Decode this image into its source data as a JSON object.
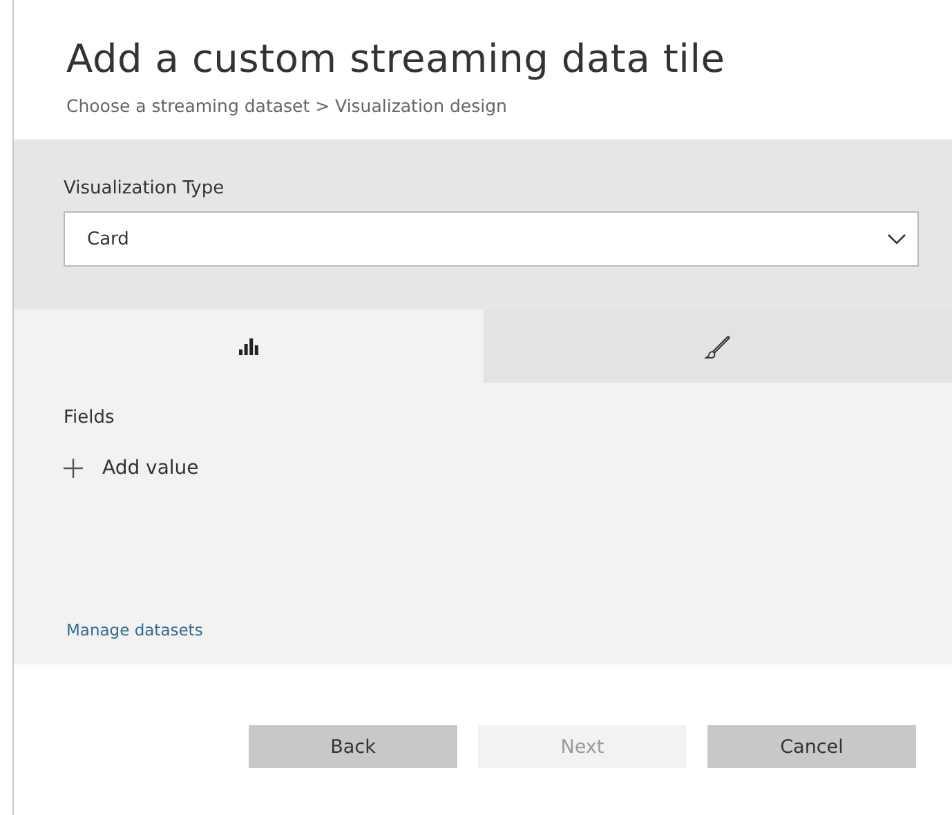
{
  "title": "Add a custom streaming data tile",
  "breadcrumb": "Choose a streaming dataset > Visualization design",
  "visualization_type": {
    "label": "Visualization Type",
    "value": "Card"
  },
  "tabs": [
    {
      "kind": "chart",
      "selected": true
    },
    {
      "kind": "brush",
      "selected": false
    }
  ],
  "fields": {
    "label": "Fields",
    "add_action": "Add value"
  },
  "link": "Manage datasets",
  "buttons": [
    {
      "label": "Back",
      "disabled": false
    },
    {
      "label": "Next",
      "disabled": true
    },
    {
      "label": "Cancel",
      "disabled": false
    }
  ]
}
